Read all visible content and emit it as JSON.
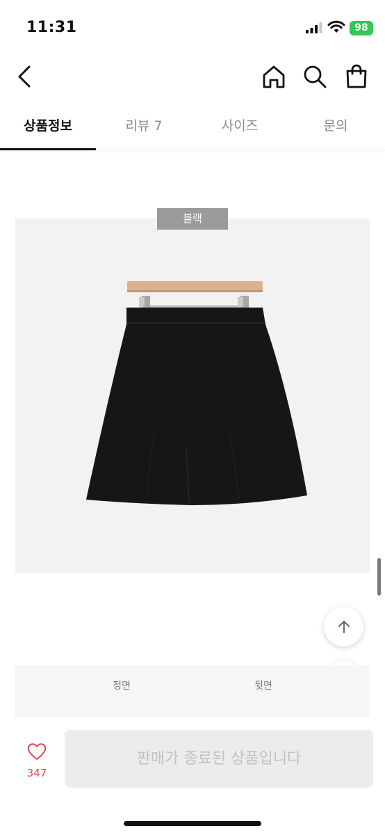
{
  "status_bar": {
    "time": "11:31",
    "battery": "98"
  },
  "header": {
    "back_icon": "chevron-left-icon",
    "home_icon": "home-icon",
    "search_icon": "search-icon",
    "cart_icon": "shopping-bag-icon"
  },
  "tabs": [
    {
      "label": "상품정보",
      "active": true
    },
    {
      "label": "리뷰 7",
      "active": false
    },
    {
      "label": "사이즈",
      "active": false
    },
    {
      "label": "문의",
      "active": false
    }
  ],
  "product": {
    "color_label": "블랙"
  },
  "floating": {
    "up_icon": "arrow-up-icon",
    "down_icon": "arrow-down-icon"
  },
  "views": {
    "front": "정면",
    "back": "뒷면"
  },
  "bottom_bar": {
    "like_icon": "heart-icon",
    "like_count": "347",
    "status_button": "판매가 종료된 상품입니다"
  },
  "colors": {
    "accent_red": "#e0444f",
    "battery_green": "#34c759"
  }
}
